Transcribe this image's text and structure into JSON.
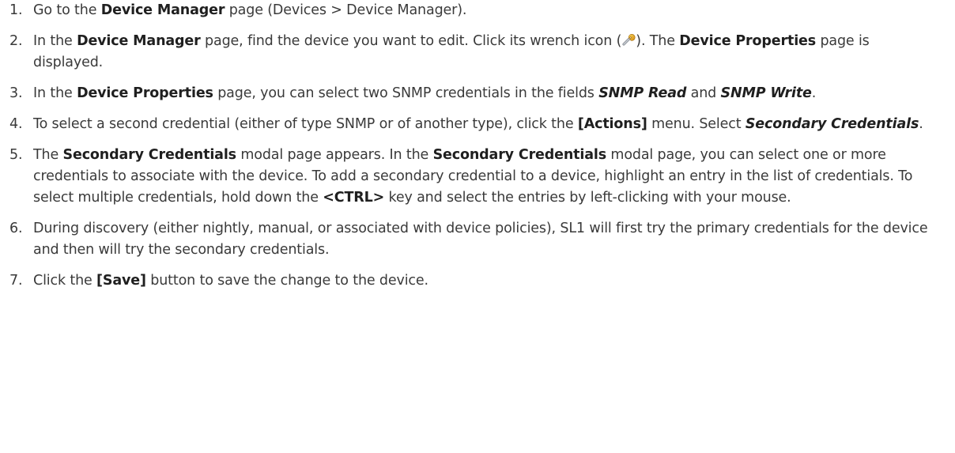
{
  "steps": [
    {
      "num": "1.",
      "parts": [
        {
          "t": "Go to the "
        },
        {
          "t": "Device Manager",
          "s": "b"
        },
        {
          "t": " page (Devices > Device Manager)."
        }
      ]
    },
    {
      "num": "2.",
      "parts": [
        {
          "t": "In the "
        },
        {
          "t": "Device Manager",
          "s": "b"
        },
        {
          "t": " page, find the device you want to edit. Click its wrench icon ("
        },
        {
          "icon": "wrench-icon"
        },
        {
          "t": "). The "
        },
        {
          "t": "Device Properties",
          "s": "b"
        },
        {
          "t": " page is displayed."
        }
      ]
    },
    {
      "num": "3.",
      "parts": [
        {
          "t": "In the "
        },
        {
          "t": "Device Properties",
          "s": "b"
        },
        {
          "t": " page, you can select two SNMP credentials in the fields "
        },
        {
          "t": "SNMP Read",
          "s": "bi"
        },
        {
          "t": " and "
        },
        {
          "t": "SNMP Write",
          "s": "bi"
        },
        {
          "t": "."
        }
      ]
    },
    {
      "num": "4.",
      "parts": [
        {
          "t": "To select a second credential (either of type SNMP or of another type), click the "
        },
        {
          "t": "[Actions]",
          "s": "b"
        },
        {
          "t": " menu. Select "
        },
        {
          "t": "Secondary Credentials",
          "s": "bi"
        },
        {
          "t": "."
        }
      ]
    },
    {
      "num": "5.",
      "parts": [
        {
          "t": "The "
        },
        {
          "t": "Secondary Credentials",
          "s": "b"
        },
        {
          "t": " modal page appears. In the "
        },
        {
          "t": "Secondary Credentials",
          "s": "b"
        },
        {
          "t": " modal page, you can select one or more credentials to associate with the device. To add a secondary credential to a device, highlight an entry in the list of credentials. To select multiple credentials, hold down the "
        },
        {
          "t": "<CTRL>",
          "s": "b"
        },
        {
          "t": " key and select the entries by left-clicking with your mouse."
        }
      ]
    },
    {
      "num": "6.",
      "parts": [
        {
          "t": "During discovery (either nightly, manual, or associated with device policies), SL1 will first try the primary credentials for the device and then will try the secondary credentials."
        }
      ]
    },
    {
      "num": "7.",
      "parts": [
        {
          "t": "Click the "
        },
        {
          "t": "[Save]",
          "s": "b"
        },
        {
          "t": " button to save the change to the device."
        }
      ]
    }
  ]
}
